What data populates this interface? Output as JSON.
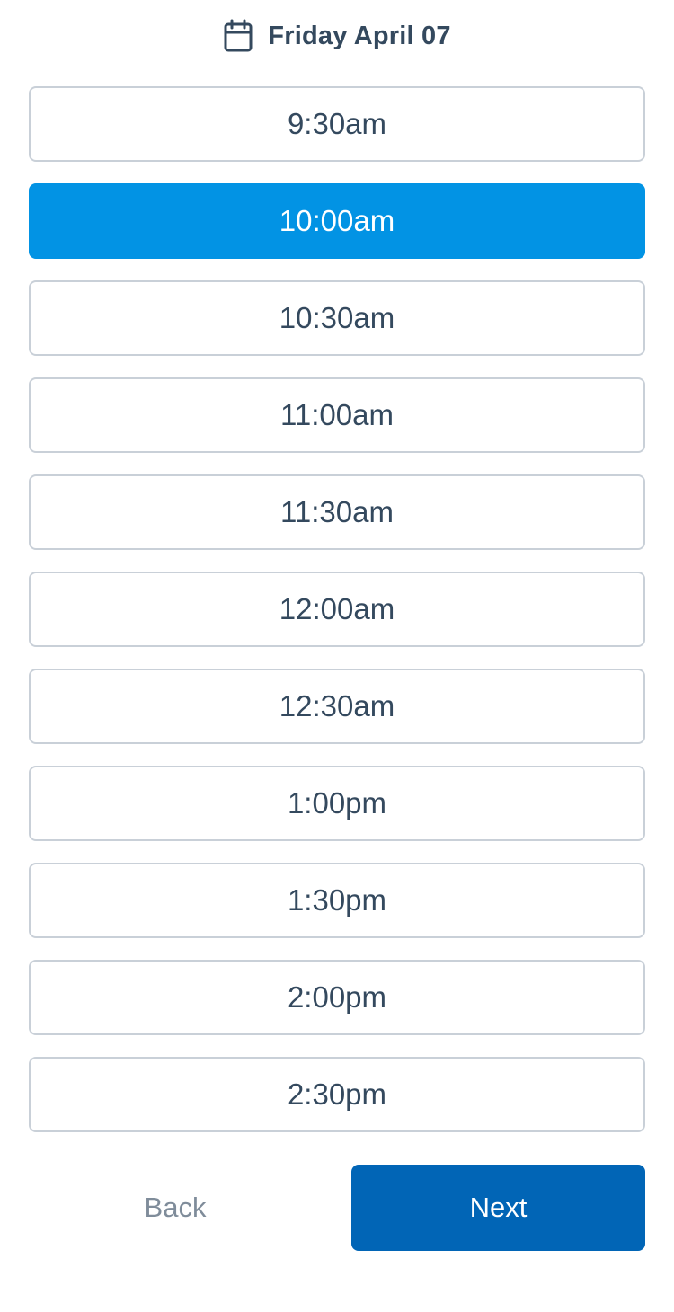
{
  "header": {
    "icon": "calendar-icon",
    "date": "Friday April 07"
  },
  "slots": [
    {
      "label": "9:30am",
      "selected": false
    },
    {
      "label": "10:00am",
      "selected": true
    },
    {
      "label": "10:30am",
      "selected": false
    },
    {
      "label": "11:00am",
      "selected": false
    },
    {
      "label": "11:30am",
      "selected": false
    },
    {
      "label": "12:00am",
      "selected": false
    },
    {
      "label": "12:30am",
      "selected": false
    },
    {
      "label": "1:00pm",
      "selected": false
    },
    {
      "label": "1:30pm",
      "selected": false
    },
    {
      "label": "2:00pm",
      "selected": false
    },
    {
      "label": "2:30pm",
      "selected": false
    }
  ],
  "footer": {
    "back_label": "Back",
    "next_label": "Next"
  },
  "colors": {
    "text": "#34495e",
    "selected_slot": "#0293e4",
    "next_button": "#0165b6",
    "slot_border": "#c9d0d8",
    "back_text": "#7f8c9a"
  }
}
